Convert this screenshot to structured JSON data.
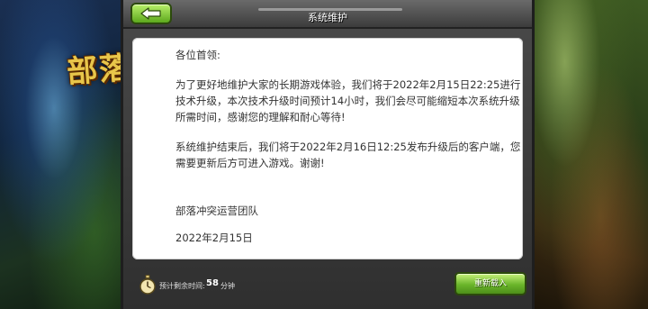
{
  "background": {
    "logo_text": "部落"
  },
  "dialog": {
    "title": "系统维护",
    "back_icon": "arrow-left-icon",
    "greeting": "各位首领:",
    "paragraph1": "为了更好地维护大家的长期游戏体验，我们将于2022年2月15日22:25进行技术升级，本次技术升级时间预计14小时，我们会尽可能缩短本次系统升级所需时间，感谢您的理解和耐心等待!",
    "paragraph2": "系统维护结束后，我们将于2022年2月16日12:25发布升级后的客户端，您需要更新后方可进入游戏。谢谢!",
    "team": "部落冲突运营团队",
    "date": "2022年2月15日"
  },
  "footer": {
    "clock_icon": "stopwatch-icon",
    "countdown_label": "预计剩余时间:",
    "countdown_value": "58",
    "countdown_unit": "分钟",
    "reenter_button": "重新载入"
  },
  "colors": {
    "button_green": "#6ab52a",
    "frame_gray": "#3c3c3c",
    "paper": "#ffffff",
    "text": "#333333"
  }
}
